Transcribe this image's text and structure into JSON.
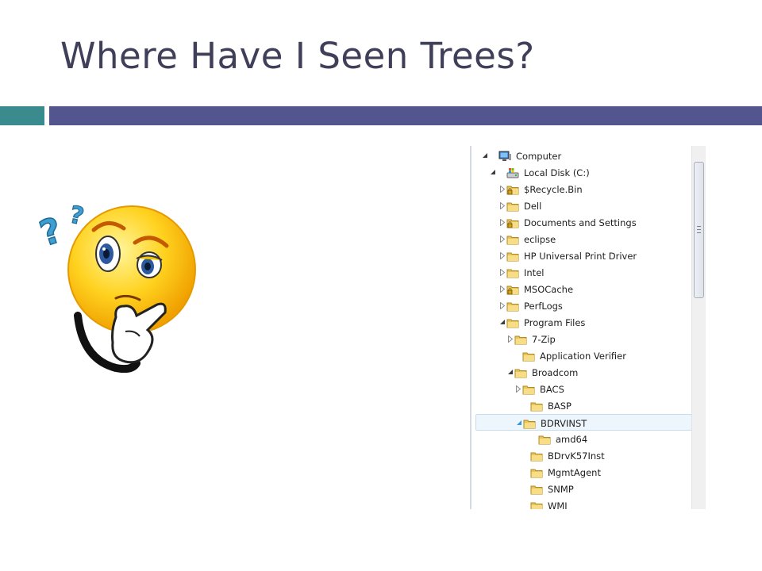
{
  "slide": {
    "title": "Where Have I Seen Trees?",
    "colors": {
      "title": "#3f3f5a",
      "accent_teal": "#3a8b8e",
      "accent_blue": "#52558e"
    },
    "illustration": "thinking-face-with-question-marks"
  },
  "tree": {
    "items": [
      {
        "label": "Computer",
        "icon": "computer-icon",
        "expander": "expanded"
      },
      {
        "label": "Local Disk (C:)",
        "icon": "drive-icon",
        "expander": "expanded"
      },
      {
        "label": "$Recycle.Bin",
        "icon": "locked-folder-icon",
        "expander": "collapsed"
      },
      {
        "label": "Dell",
        "icon": "folder-icon",
        "expander": "collapsed"
      },
      {
        "label": "Documents and Settings",
        "icon": "locked-folder-icon",
        "expander": "collapsed"
      },
      {
        "label": "eclipse",
        "icon": "folder-icon",
        "expander": "collapsed"
      },
      {
        "label": "HP Universal Print Driver",
        "icon": "folder-icon",
        "expander": "collapsed"
      },
      {
        "label": "Intel",
        "icon": "folder-icon",
        "expander": "collapsed"
      },
      {
        "label": "MSOCache",
        "icon": "locked-folder-icon",
        "expander": "collapsed"
      },
      {
        "label": "PerfLogs",
        "icon": "folder-icon",
        "expander": "collapsed"
      },
      {
        "label": "Program Files",
        "icon": "folder-icon",
        "expander": "expanded"
      },
      {
        "label": "7-Zip",
        "icon": "folder-icon",
        "expander": "collapsed"
      },
      {
        "label": "Application Verifier",
        "icon": "folder-icon",
        "expander": "none"
      },
      {
        "label": "Broadcom",
        "icon": "folder-icon",
        "expander": "expanded"
      },
      {
        "label": "BACS",
        "icon": "folder-icon",
        "expander": "collapsed"
      },
      {
        "label": "BASP",
        "icon": "folder-icon",
        "expander": "none"
      },
      {
        "label": "BDRVINST",
        "icon": "folder-icon",
        "expander": "expanded",
        "selected": true
      },
      {
        "label": "amd64",
        "icon": "folder-icon",
        "expander": "none"
      },
      {
        "label": "BDrvK57Inst",
        "icon": "folder-icon",
        "expander": "none"
      },
      {
        "label": "MgmtAgent",
        "icon": "folder-icon",
        "expander": "none"
      },
      {
        "label": "SNMP",
        "icon": "folder-icon",
        "expander": "none"
      },
      {
        "label": "WMI",
        "icon": "folder-icon",
        "expander": "none"
      }
    ]
  }
}
